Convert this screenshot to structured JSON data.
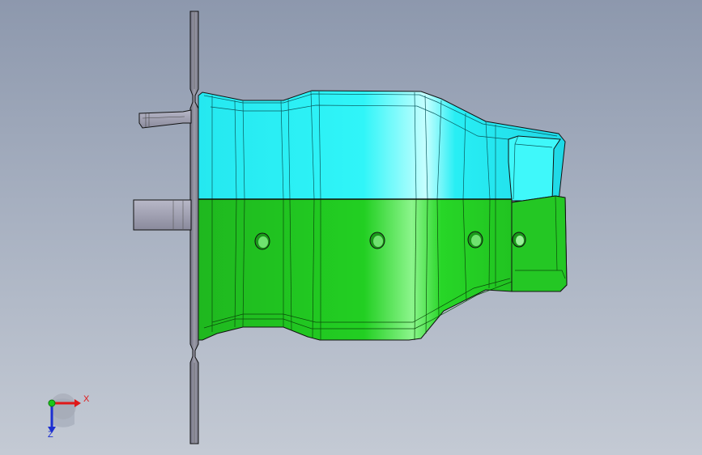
{
  "viewport": {
    "background_top": "#8d98ad",
    "background_bottom": "#c4cad4"
  },
  "model": {
    "upper_face_color": "#22f3f6",
    "lower_face_color": "#22cf22",
    "flange_color": "#8e8e9c",
    "edge_color": "#111111"
  },
  "triad": {
    "x_label": "X",
    "z_label": "Z",
    "x_color": "#e01818",
    "y_color": "#18c818",
    "z_color": "#1c2fd1"
  }
}
